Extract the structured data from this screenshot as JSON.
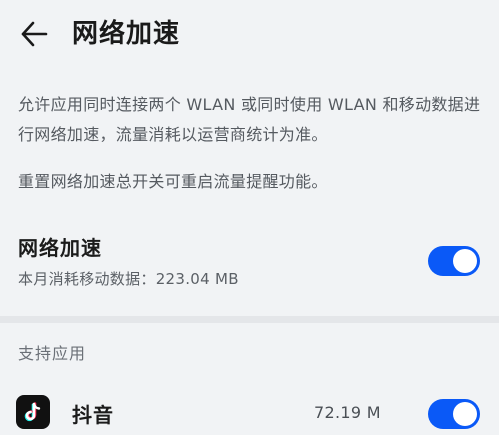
{
  "header": {
    "back_icon": "arrow-left-icon",
    "title": "网络加速"
  },
  "description": {
    "line1": "允许应用同时连接两个 WLAN 或同时使用 WLAN 和移动数据进行网络加速，流量消耗以运营商统计为准。",
    "line2": "重置网络加速总开关可重启流量提醒功能。"
  },
  "network_boost": {
    "title": "网络加速",
    "subtitle": "本月消耗移动数据：223.04 MB",
    "enabled": true
  },
  "supported_apps": {
    "section_label": "支持应用",
    "items": [
      {
        "name": "抖音",
        "icon": "douyin-icon",
        "usage": "72.19 M",
        "enabled": true
      }
    ]
  },
  "colors": {
    "accent": "#0a59f7",
    "background": "#f1f3f5",
    "text_primary": "#1b1b1b",
    "text_secondary": "#555a60"
  }
}
